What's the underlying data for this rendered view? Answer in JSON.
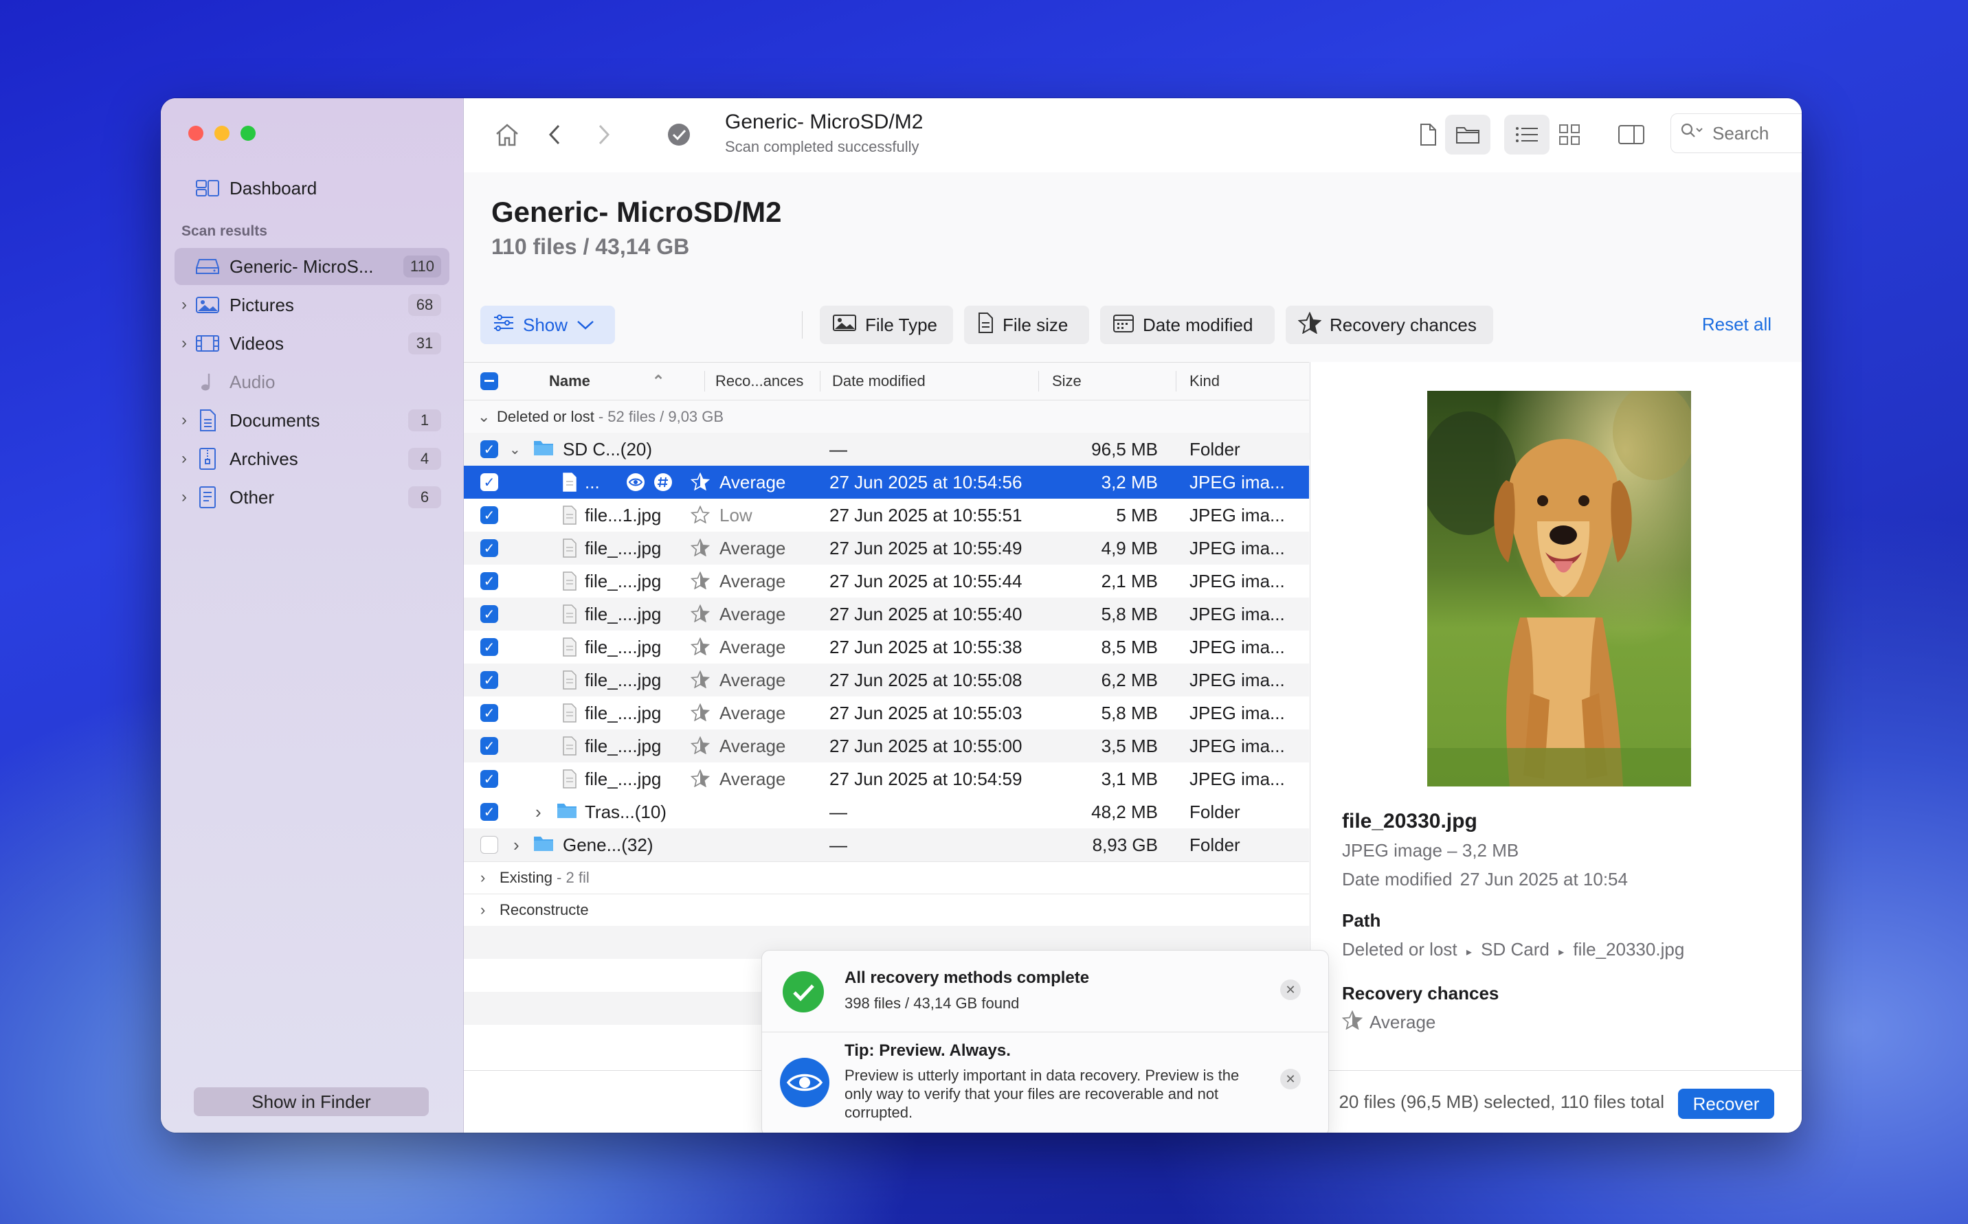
{
  "sidebar": {
    "dashboard": "Dashboard",
    "section": "Scan results",
    "items": [
      {
        "label": "Generic- MicroS...",
        "count": "110"
      },
      {
        "label": "Pictures",
        "count": "68"
      },
      {
        "label": "Videos",
        "count": "31"
      },
      {
        "label": "Audio",
        "count": ""
      },
      {
        "label": "Documents",
        "count": "1"
      },
      {
        "label": "Archives",
        "count": "4"
      },
      {
        "label": "Other",
        "count": "6"
      }
    ],
    "show_in_finder": "Show in Finder"
  },
  "toolbar": {
    "title": "Generic- MicroSD/M2",
    "subtitle": "Scan completed successfully",
    "search_placeholder": "Search"
  },
  "header": {
    "title": "Generic- MicroSD/M2",
    "subtitle": "110 files / 43,14 GB"
  },
  "filters": {
    "show": "Show",
    "file_type": "File Type",
    "file_size": "File size",
    "date_modified": "Date modified",
    "recovery_chances": "Recovery chances",
    "reset_all": "Reset all"
  },
  "table": {
    "columns": [
      "Name",
      "Reco...ances",
      "Date modified",
      "Size",
      "Kind"
    ],
    "group_deleted": {
      "label": "Deleted or lost",
      "meta": "- 52 files / 9,03 GB"
    },
    "folder_sd": {
      "name": "SD C...(20)",
      "date": "—",
      "size": "96,5 MB",
      "kind": "Folder"
    },
    "rows": [
      {
        "name": "...",
        "chance": "Average",
        "date": "27 Jun 2025 at 10:54:56",
        "size": "3,2 MB",
        "kind": "JPEG ima..."
      },
      {
        "name": "file...1.jpg",
        "chance": "Low",
        "date": "27 Jun 2025 at 10:55:51",
        "size": "5 MB",
        "kind": "JPEG ima..."
      },
      {
        "name": "file_....jpg",
        "chance": "Average",
        "date": "27 Jun 2025 at 10:55:49",
        "size": "4,9 MB",
        "kind": "JPEG ima..."
      },
      {
        "name": "file_....jpg",
        "chance": "Average",
        "date": "27 Jun 2025 at 10:55:44",
        "size": "2,1 MB",
        "kind": "JPEG ima..."
      },
      {
        "name": "file_....jpg",
        "chance": "Average",
        "date": "27 Jun 2025 at 10:55:40",
        "size": "5,8 MB",
        "kind": "JPEG ima..."
      },
      {
        "name": "file_....jpg",
        "chance": "Average",
        "date": "27 Jun 2025 at 10:55:38",
        "size": "8,5 MB",
        "kind": "JPEG ima..."
      },
      {
        "name": "file_....jpg",
        "chance": "Average",
        "date": "27 Jun 2025 at 10:55:08",
        "size": "6,2 MB",
        "kind": "JPEG ima..."
      },
      {
        "name": "file_....jpg",
        "chance": "Average",
        "date": "27 Jun 2025 at 10:55:03",
        "size": "5,8 MB",
        "kind": "JPEG ima..."
      },
      {
        "name": "file_....jpg",
        "chance": "Average",
        "date": "27 Jun 2025 at 10:55:00",
        "size": "3,5 MB",
        "kind": "JPEG ima..."
      },
      {
        "name": "file_....jpg",
        "chance": "Average",
        "date": "27 Jun 2025 at 10:54:59",
        "size": "3,1 MB",
        "kind": "JPEG ima..."
      }
    ],
    "folder_tras": {
      "name": "Tras...(10)",
      "date": "—",
      "size": "48,2 MB",
      "kind": "Folder"
    },
    "folder_gene": {
      "name": "Gene...(32)",
      "date": "—",
      "size": "8,93 GB",
      "kind": "Folder"
    },
    "group_existing": {
      "label": "Existing",
      "meta": "- 2 fil"
    },
    "group_reconstructed": {
      "label": "Reconstructe"
    }
  },
  "toast": {
    "title": "All recovery methods complete",
    "sub": "398 files / 43,14 GB found",
    "tip_title": "Tip: Preview. Always.",
    "tip_body": "Preview is utterly important in data recovery. Preview is the only way to verify that your files are recoverable and not corrupted."
  },
  "preview": {
    "filename": "file_20330.jpg",
    "type": "JPEG image – 3,2 MB",
    "date_label": "Date modified",
    "date_value": "27 Jun 2025 at 10:54",
    "path_label": "Path",
    "path_parts": [
      "Deleted or lost",
      "SD Card",
      "file_20330.jpg"
    ],
    "recovery_label": "Recovery chances",
    "recovery_value": "Average"
  },
  "footer": {
    "status": "20 files (96,5 MB) selected, 110 files total",
    "recover": "Recover"
  },
  "colors": {
    "accent": "#1a6ce0",
    "selection": "#1a5fe0",
    "success": "#2fb344"
  }
}
